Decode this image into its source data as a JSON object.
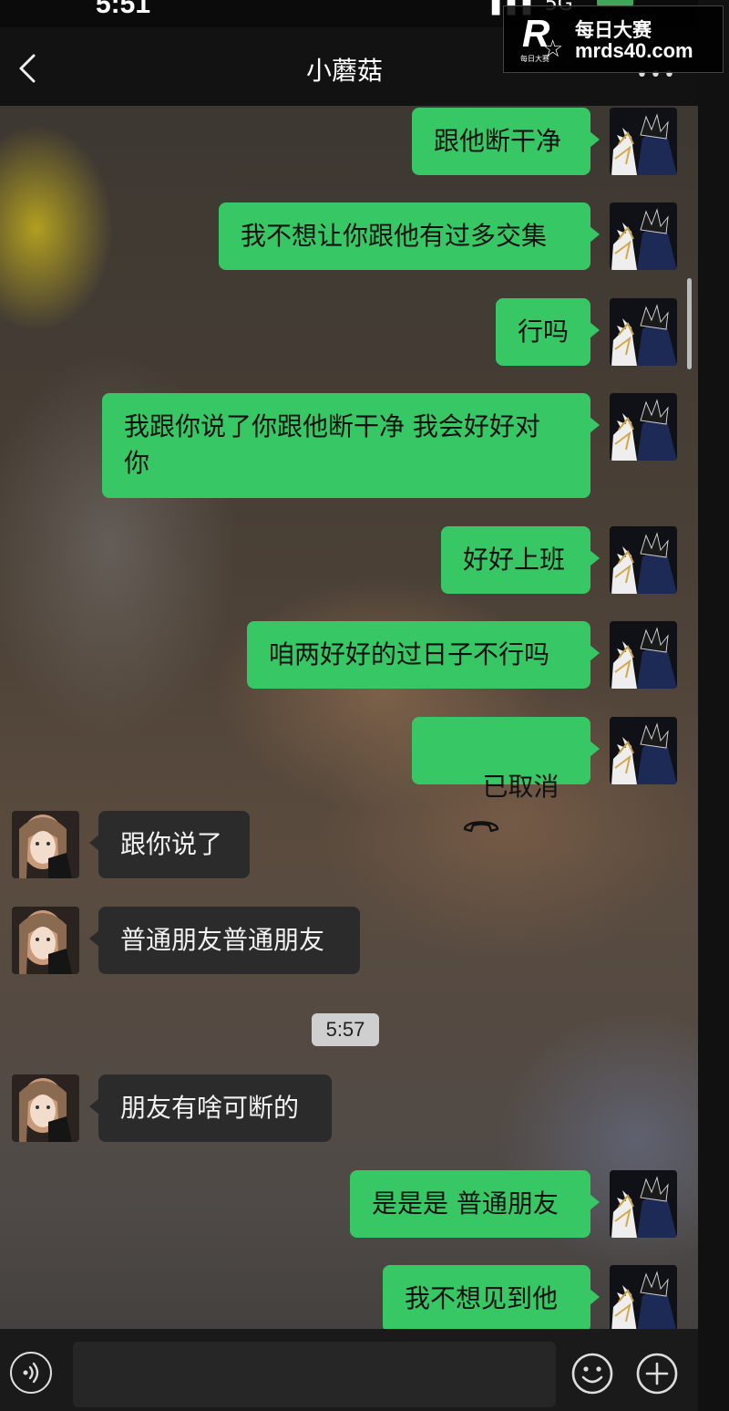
{
  "status": {
    "time": "5:51",
    "signal": "▌▌▌ 5G"
  },
  "header": {
    "title": "小蘑菇",
    "more": "•••"
  },
  "watermark": {
    "cn": "每日大赛",
    "url": "mrds40.com",
    "logo": "R",
    "logo_sub": "每日大赛"
  },
  "messages": [
    {
      "text": "跟他断干净",
      "side": "out"
    },
    {
      "text": "我不想让你跟他有过多交集",
      "side": "out"
    },
    {
      "text": "行吗",
      "side": "out"
    },
    {
      "text": "我跟你说了你跟他断干净 我会好好对\n你",
      "side": "out"
    },
    {
      "text": "好好上班",
      "side": "out"
    },
    {
      "text": "咱两好好的过日子不行吗",
      "side": "out"
    },
    {
      "text": "已取消",
      "side": "out",
      "call": true
    },
    {
      "text": "跟你说了",
      "side": "in"
    },
    {
      "text": "普通朋友普通朋友",
      "side": "in"
    },
    {
      "text": "朋友有啥可断的",
      "side": "in"
    },
    {
      "text": "是是是 普通朋友",
      "side": "out"
    },
    {
      "text": "我不想见到他",
      "side": "out"
    }
  ],
  "timestamp": "5:57",
  "input": {
    "value": ""
  },
  "colors": {
    "outgoing": "#38c765",
    "incoming": "#2b2b2b",
    "bar": "#121212"
  }
}
